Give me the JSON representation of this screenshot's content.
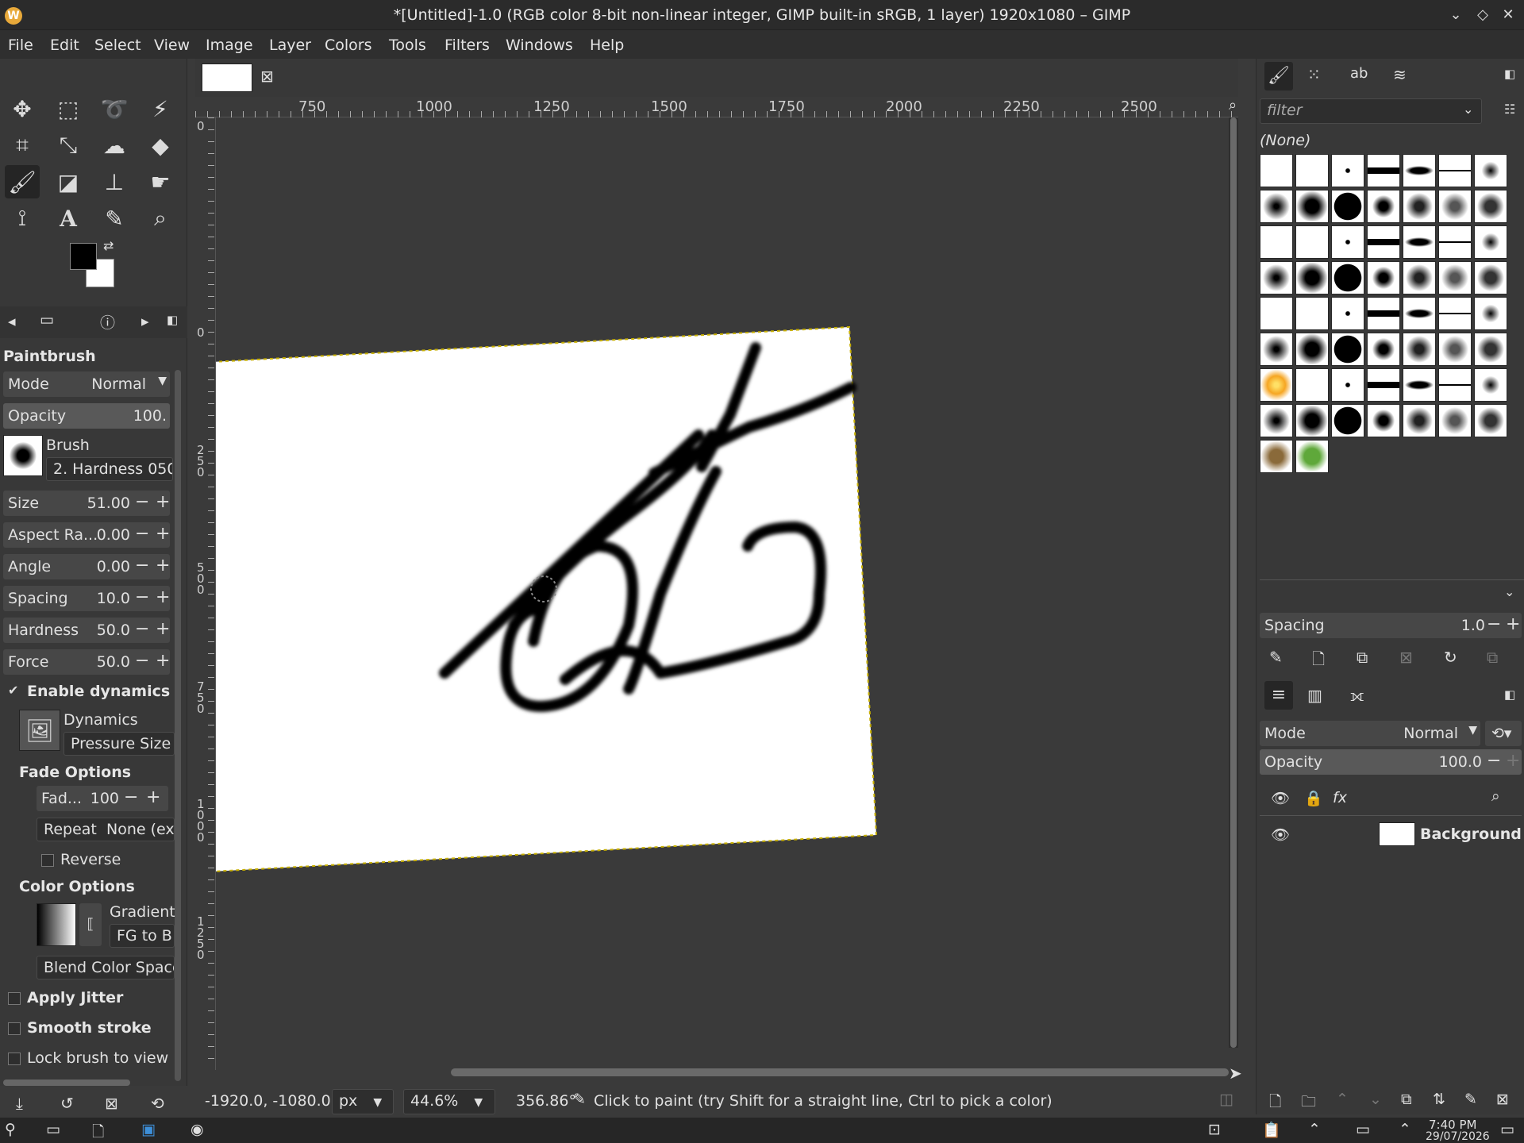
{
  "window": {
    "title": "*[Untitled]-1.0 (RGB color 8-bit non-linear integer, GIMP built-in sRGB, 1 layer) 1920x1080 – GIMP",
    "app_icon": "W"
  },
  "menu": [
    "File",
    "Edit",
    "Select",
    "View",
    "Image",
    "Layer",
    "Colors",
    "Tools",
    "Filters",
    "Windows",
    "Help"
  ],
  "tool_options": {
    "title": "Paintbrush",
    "mode_label": "Mode",
    "mode_value": "Normal",
    "opacity_label": "Opacity",
    "opacity_value": "100.",
    "brush_label": "Brush",
    "brush_value": "2. Hardness 050",
    "size": {
      "label": "Size",
      "value": "51.00"
    },
    "aspect": {
      "label": "Aspect Ra...",
      "value": "0.00"
    },
    "angle": {
      "label": "Angle",
      "value": "0.00"
    },
    "spacing": {
      "label": "Spacing",
      "value": "10.0"
    },
    "hardness": {
      "label": "Hardness",
      "value": "50.0"
    },
    "force": {
      "label": "Force",
      "value": "50.0"
    },
    "enable_dynamics": "Enable dynamics",
    "dynamics_label": "Dynamics",
    "dynamics_value": "Pressure Size",
    "fade_options": "Fade Options",
    "fade_label": "Fad...",
    "fade_value": "100",
    "repeat_label": "Repeat",
    "repeat_value": "None (exte",
    "reverse": "Reverse",
    "color_options": "Color Options",
    "gradient_label": "Gradient",
    "gradient_value": "FG to B",
    "blend_color_space": "Blend Color Space",
    "apply_jitter": "Apply Jitter",
    "smooth_stroke": "Smooth stroke",
    "lock_brush": "Lock brush to view"
  },
  "rulers": {
    "top": [
      "750",
      "1000",
      "1250",
      "1500",
      "1750",
      "2000",
      "2250",
      "2500"
    ],
    "left": [
      "0",
      "0",
      "250",
      "0",
      "500",
      "0",
      "750",
      "0",
      "1000",
      "1250"
    ]
  },
  "brushes_panel": {
    "filter_placeholder": "filter",
    "selected_name": "(None)",
    "spacing_label": "Spacing",
    "spacing_value": "1.0"
  },
  "layers_panel": {
    "mode_label": "Mode",
    "mode_value": "Normal",
    "opacity_label": "Opacity",
    "opacity_value": "100.0",
    "layer_name": "Background"
  },
  "status": {
    "coords": "-1920.0, -1080.0",
    "unit": "px",
    "zoom": "44.6%",
    "angle": "356.86°",
    "message": "Click to paint (try Shift for a straight line, Ctrl to pick a color)"
  },
  "taskbar": {
    "time": "7:40 PM",
    "date": "29/07/2026"
  },
  "colors": {
    "fg": "#000000",
    "bg": "#ffffff",
    "accent": "#e8a93a"
  }
}
